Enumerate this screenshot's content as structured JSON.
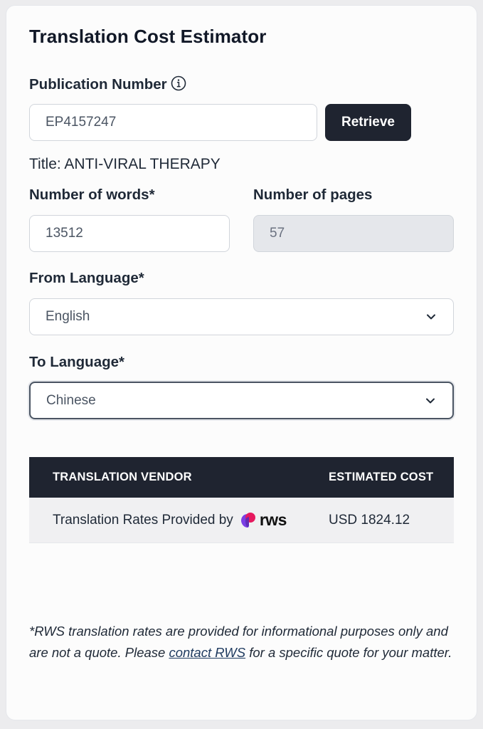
{
  "estimator": {
    "title": "Translation Cost Estimator"
  },
  "publication": {
    "label": "Publication Number",
    "value": "EP4157247",
    "retrieve_label": "Retrieve",
    "title_line": "Title: ANTI-VIRAL THERAPY"
  },
  "words": {
    "label": "Number of words*",
    "value": "13512"
  },
  "pages": {
    "label": "Number of pages",
    "value": "57"
  },
  "from_language": {
    "label": "From Language*",
    "selected": "English"
  },
  "to_language": {
    "label": "To Language*",
    "selected": "Chinese"
  },
  "table": {
    "headers": [
      "TRANSLATION VENDOR",
      "ESTIMATED COST"
    ],
    "rows": [
      {
        "vendor": "Translation Rates Provided by",
        "vendor_logo": "rws",
        "cost": "USD 1824.12"
      }
    ]
  },
  "footnote": {
    "before": "*RWS translation rates are provided for informational purposes only and are not a quote. Please ",
    "link": "contact RWS",
    "after": " for a specific quote for your matter."
  },
  "colors": {
    "header_bg": "#1f2430",
    "button_bg": "#1f2430",
    "row_bg": "#f0f0f2",
    "logo_pink": "#e6195f",
    "logo_purple": "#7b3fe4"
  },
  "icons": {
    "info": "info-icon",
    "select_arrow": "chevron-down-icon",
    "vendor_logo": "rws-logo"
  }
}
